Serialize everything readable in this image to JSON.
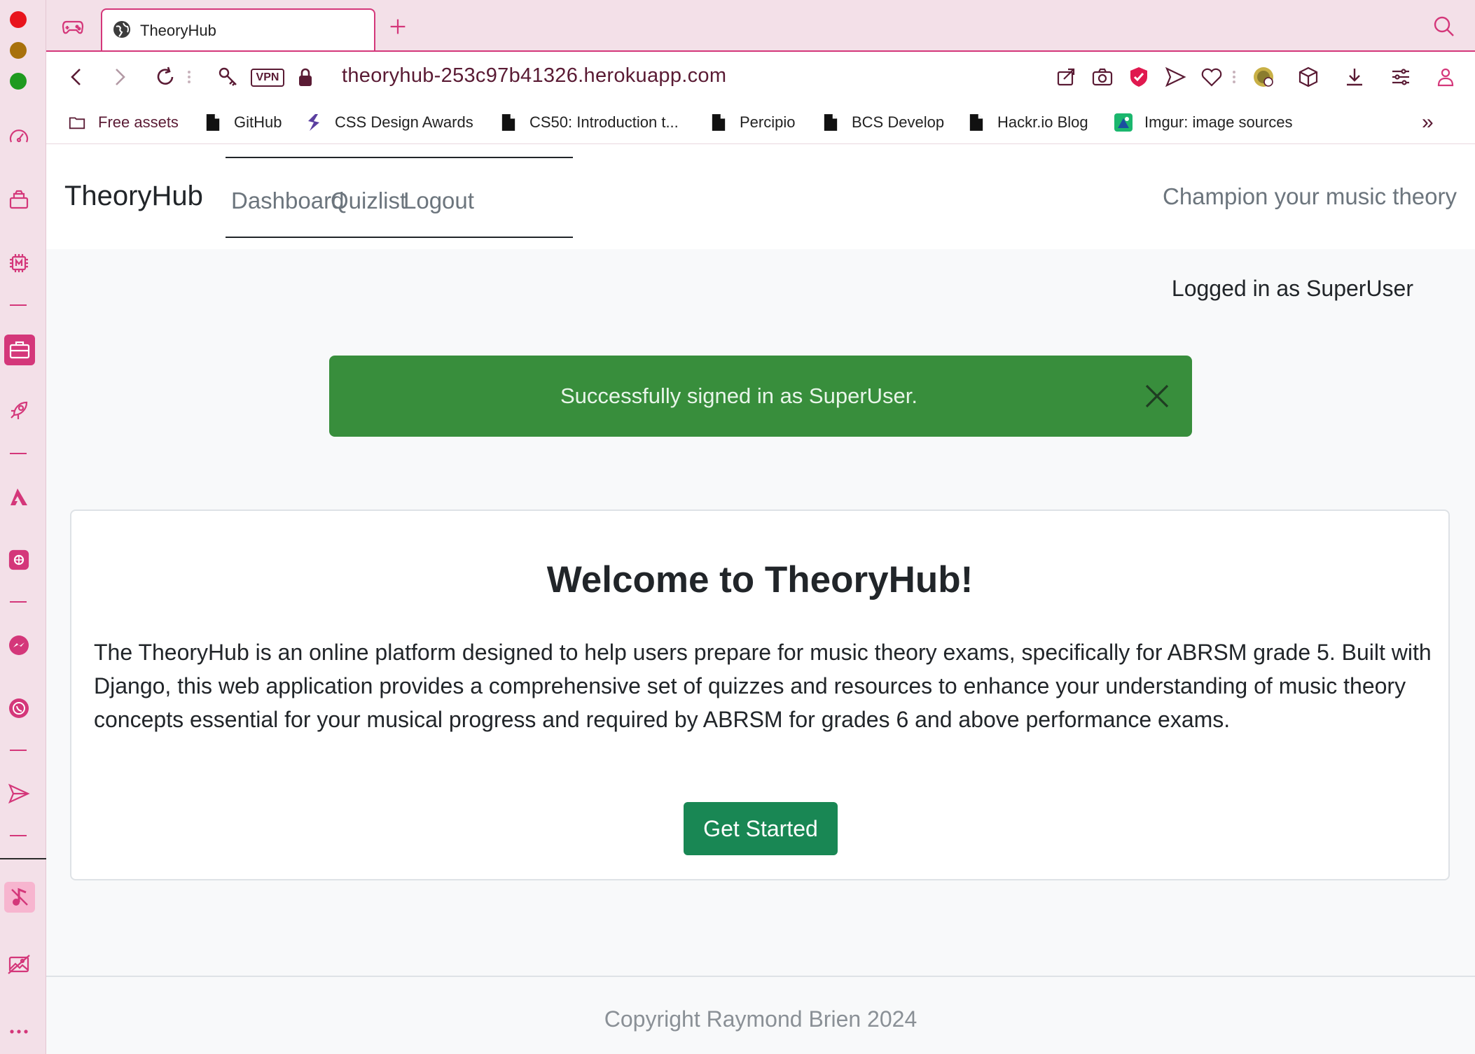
{
  "browser": {
    "tab": {
      "title": "TheoryHub"
    },
    "address": {
      "url": "theoryhub-253c97b41326.herokuapp.com",
      "vpn_label": "VPN"
    },
    "bookmarks": [
      {
        "label": "Free assets",
        "icon": "folder-icon"
      },
      {
        "label": "GitHub",
        "icon": "document-icon"
      },
      {
        "label": "CSS Design Awards",
        "icon": "css-design-awards-icon"
      },
      {
        "label": "CS50: Introduction t...",
        "icon": "document-icon"
      },
      {
        "label": "Percipio",
        "icon": "document-icon"
      },
      {
        "label": "BCS Develop",
        "icon": "document-icon"
      },
      {
        "label": "Hackr.io Blog",
        "icon": "document-icon"
      },
      {
        "label": "Imgur: image sources",
        "icon": "imgur-icon"
      }
    ],
    "overflow_label": "»",
    "accent_color": "#d4377a"
  },
  "site": {
    "brand": "TheoryHub",
    "nav": [
      "Dashboard",
      "Quizlist",
      "Logout"
    ],
    "tagline": "Champion your music theory",
    "logged_in": "Logged in as SuperUser",
    "alert": {
      "message": "Successfully signed in as SuperUser.",
      "color": "#388e3c"
    },
    "card": {
      "title": "Welcome to TheoryHub!",
      "body": "The TheoryHub is an online platform designed to help users prepare for music theory exams, specifically for ABRSM grade 5. Built with Django, this web application provides a comprehensive set of quizzes and resources to enhance your understanding of music theory concepts essential for your musical progress and required by ABRSM for grades 6 and above performance exams.",
      "button": "Get Started",
      "button_color": "#198754"
    },
    "footer": "Copyright Raymond Brien 2024"
  }
}
